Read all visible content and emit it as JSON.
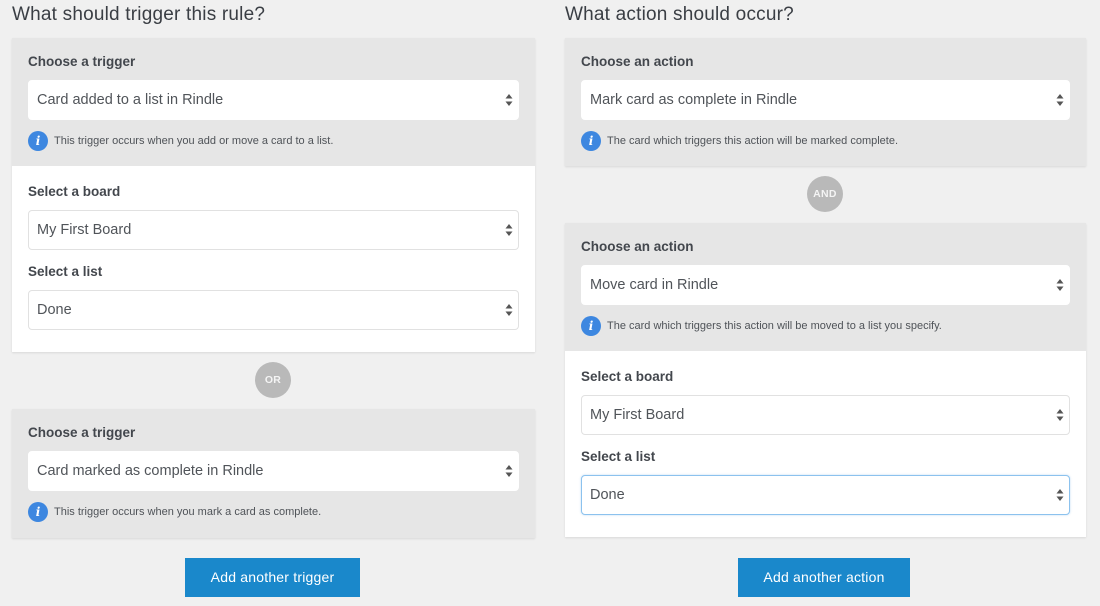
{
  "triggers": {
    "title": "What should trigger this rule?",
    "blocks": [
      {
        "choose_label": "Choose a trigger",
        "selected": "Card added to a list in Rindle",
        "info": "This trigger occurs when you add or move a card to a list.",
        "board_label": "Select a board",
        "board_value": "My First Board",
        "list_label": "Select a list",
        "list_value": "Done"
      },
      {
        "choose_label": "Choose a trigger",
        "selected": "Card marked as complete in Rindle",
        "info": "This trigger occurs when you mark a card as complete."
      }
    ],
    "connector": "OR",
    "add_button": "Add another trigger"
  },
  "actions": {
    "title": "What action should occur?",
    "blocks": [
      {
        "choose_label": "Choose an action",
        "selected": "Mark card as complete in Rindle",
        "info": "The card which triggers this action will be marked complete."
      },
      {
        "choose_label": "Choose an action",
        "selected": "Move card in Rindle",
        "info": "The card which triggers this action will be moved to a list you specify.",
        "board_label": "Select a board",
        "board_value": "My First Board",
        "list_label": "Select a list",
        "list_value": "Done"
      }
    ],
    "connector": "AND",
    "add_button": "Add another action"
  },
  "icons": {
    "info": "i",
    "select_arrows": "up-down-arrows"
  },
  "colors": {
    "accent": "#1a88cb",
    "info_icon": "#3d87e0",
    "focus_border": "#8cc2ee",
    "connector": "#b9b9b9"
  }
}
